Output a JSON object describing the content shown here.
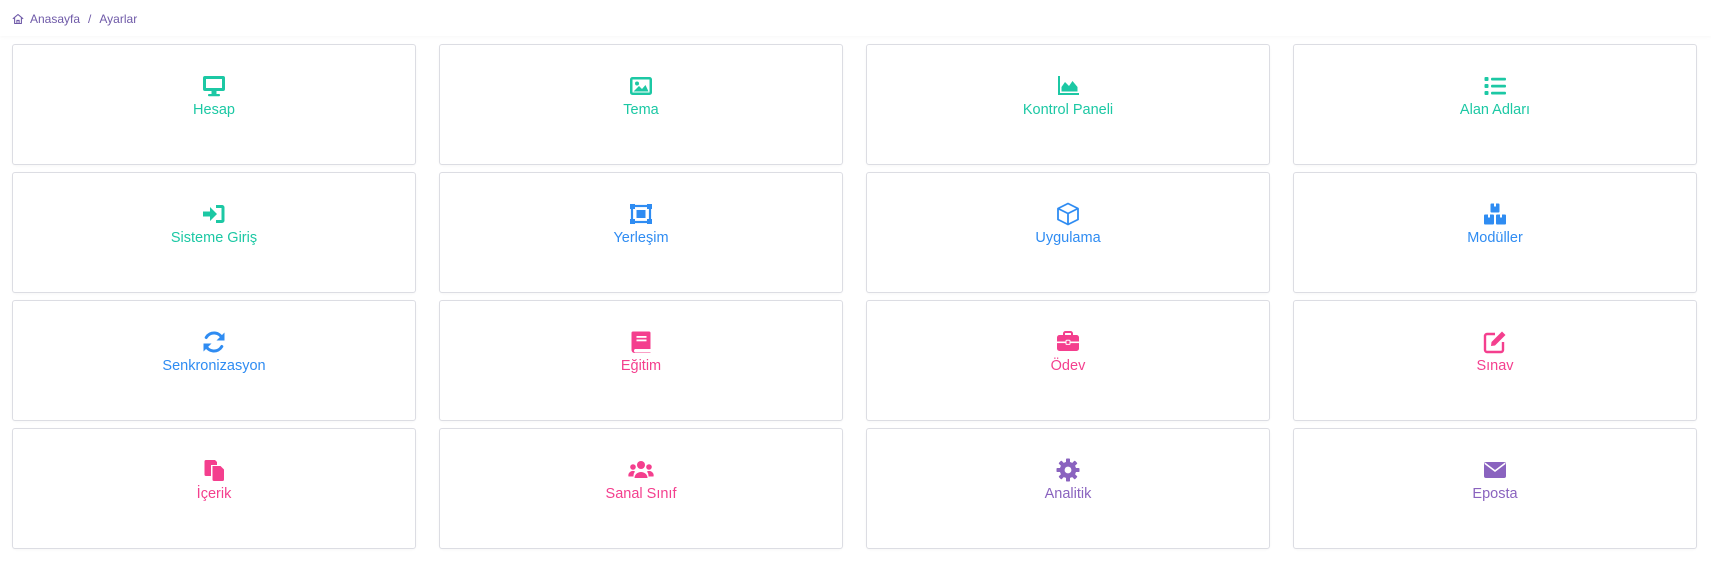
{
  "breadcrumb": {
    "home": "Anasayfa",
    "separator": "/",
    "current": "Ayarlar"
  },
  "colors": {
    "teal": "#1cc8a4",
    "blue": "#2f8cf2",
    "pink": "#f43f8e",
    "purple": "#8a63bf",
    "breadcrumb": "#6f5aa8"
  },
  "cards": [
    {
      "label": "Hesap",
      "icon": "monitor-icon",
      "color": "#1cc8a4"
    },
    {
      "label": "Tema",
      "icon": "image-icon",
      "color": "#1cc8a4"
    },
    {
      "label": "Kontrol Paneli",
      "icon": "area-chart-icon",
      "color": "#1cc8a4"
    },
    {
      "label": "Alan Adları",
      "icon": "list-icon",
      "color": "#1cc8a4"
    },
    {
      "label": "Sisteme Giriş",
      "icon": "sign-in-icon",
      "color": "#1cc8a4"
    },
    {
      "label": "Yerleşim",
      "icon": "object-group-icon",
      "color": "#2f8cf2"
    },
    {
      "label": "Uygulama",
      "icon": "cube-icon",
      "color": "#2f8cf2"
    },
    {
      "label": "Modüller",
      "icon": "cubes-icon",
      "color": "#2f8cf2"
    },
    {
      "label": "Senkronizasyon",
      "icon": "sync-icon",
      "color": "#2f8cf2"
    },
    {
      "label": "Eğitim",
      "icon": "book-icon",
      "color": "#f43f8e"
    },
    {
      "label": "Ödev",
      "icon": "briefcase-icon",
      "color": "#f43f8e"
    },
    {
      "label": "Sınav",
      "icon": "edit-icon",
      "color": "#f43f8e"
    },
    {
      "label": "İçerik",
      "icon": "copy-icon",
      "color": "#f43f8e"
    },
    {
      "label": "Sanal Sınıf",
      "icon": "users-icon",
      "color": "#f43f8e"
    },
    {
      "label": "Analitik",
      "icon": "gear-icon",
      "color": "#8a63bf"
    },
    {
      "label": "Eposta",
      "icon": "envelope-icon",
      "color": "#8a63bf"
    }
  ]
}
